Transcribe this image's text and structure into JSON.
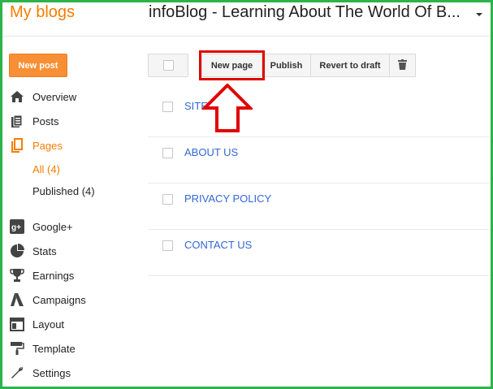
{
  "header": {
    "brand": "My blogs",
    "blog_title": "infoBlog - Learning About The World Of B...",
    "dropdown_icon": "chevron-down-icon"
  },
  "sidebar": {
    "new_post_label": "New post",
    "items": [
      {
        "label": "Overview",
        "icon": "home-icon"
      },
      {
        "label": "Posts",
        "icon": "posts-icon"
      },
      {
        "label": "Pages",
        "icon": "pages-icon"
      },
      {
        "label": "Google+",
        "icon": "google-plus-icon"
      },
      {
        "label": "Stats",
        "icon": "pie-chart-icon"
      },
      {
        "label": "Earnings",
        "icon": "trophy-icon"
      },
      {
        "label": "Campaigns",
        "icon": "adwords-icon"
      },
      {
        "label": "Layout",
        "icon": "layout-icon"
      },
      {
        "label": "Template",
        "icon": "paint-roller-icon"
      },
      {
        "label": "Settings",
        "icon": "wrench-icon"
      }
    ],
    "pages_sub": {
      "all": "All (4)",
      "published": "Published (4)"
    }
  },
  "toolbar": {
    "new_page_label": "New page",
    "publish_label": "Publish",
    "revert_label": "Revert to draft",
    "delete_icon": "trash-icon"
  },
  "pages": [
    {
      "title": "SITE"
    },
    {
      "title": "ABOUT US"
    },
    {
      "title": "PRIVACY POLICY"
    },
    {
      "title": "CONTACT US"
    }
  ],
  "colors": {
    "accent": "#f57d00",
    "link": "#3367d6",
    "highlight": "#e00000",
    "frame": "#2db34a"
  }
}
